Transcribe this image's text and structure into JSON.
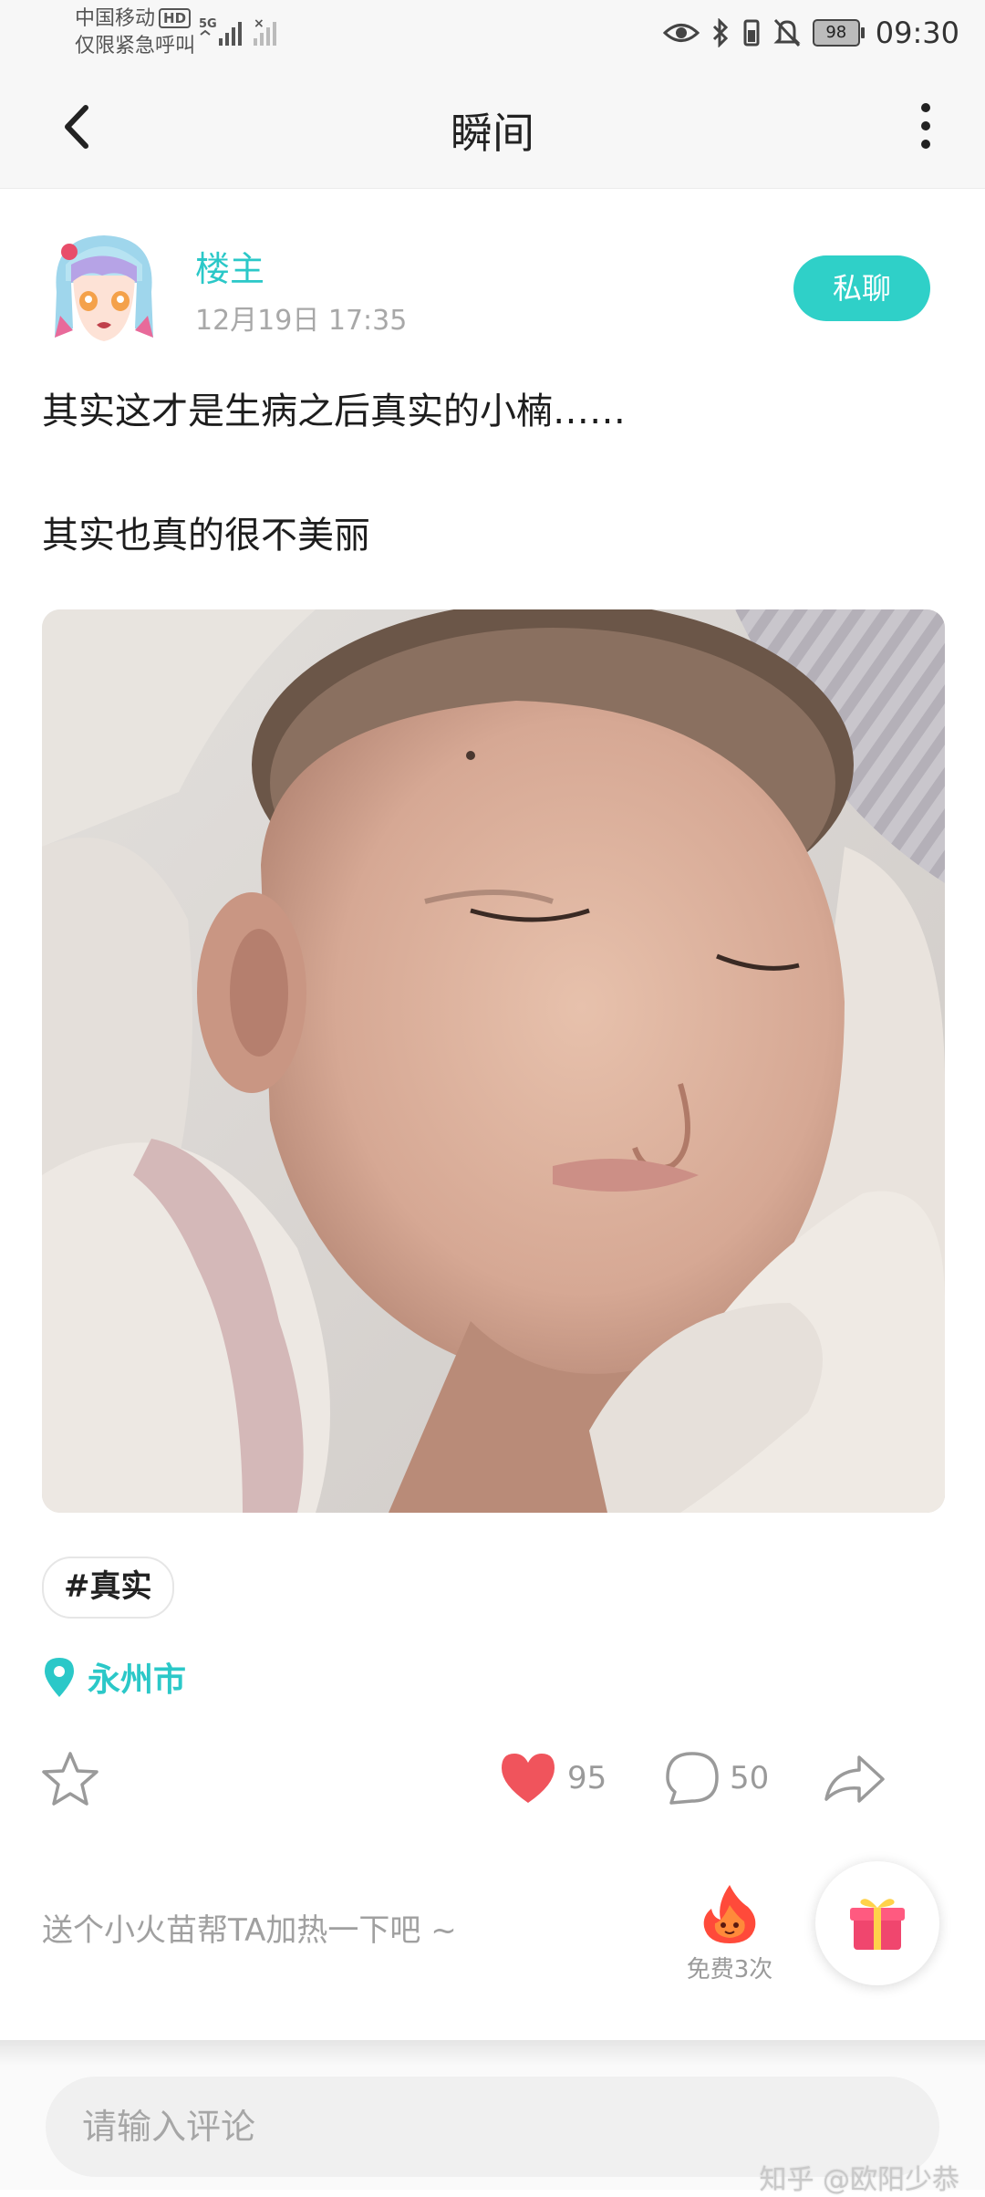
{
  "status_bar": {
    "carrier": "中国移动",
    "carrier_badge": "HD",
    "emergency": "仅限紧急呼叫",
    "network": "5G",
    "battery": "98",
    "time": "09:30",
    "icons": [
      "eye-icon",
      "bluetooth-icon",
      "vibrate-battery-icon",
      "bell-muted-icon"
    ]
  },
  "header": {
    "title": "瞬间",
    "back_icon": "back-chevron-icon",
    "more_icon": "more-vertical-icon"
  },
  "post": {
    "author": "楼主",
    "time": "12月19日 17:35",
    "dm_label": "私聊",
    "text_lines": [
      "其实这才是生病之后真实的小楠……",
      "其实也真的很不美丽"
    ],
    "tag": "#真实",
    "location": "永州市"
  },
  "actions": {
    "likes": "95",
    "comments": "50"
  },
  "fire": {
    "prompt": "送个小火苗帮TA加热一下吧 ~",
    "free_label": "免费3次"
  },
  "comment": {
    "placeholder": "请输入评论"
  },
  "watermark": "知乎 @欧阳少恭",
  "colors": {
    "accent": "#2bc8c8",
    "like": "#f0545c",
    "button": "#2fd0c8"
  }
}
